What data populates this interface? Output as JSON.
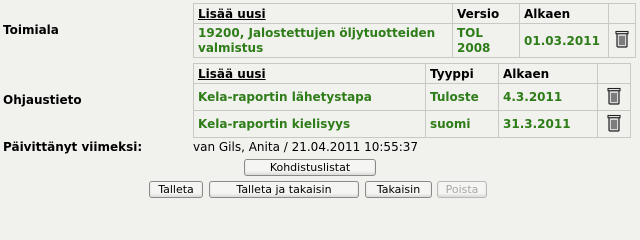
{
  "toimiala": {
    "label": "Toimiala",
    "add_link": "Lisää uusi",
    "col_versio": "Versio",
    "col_alkaen": "Alkaen",
    "row": {
      "name": "19200, Jalostettujen öljytuotteiden valmistus",
      "versio": "TOL 2008",
      "alkaen": "01.03.2011"
    }
  },
  "ohjaustieto": {
    "label": "Ohjaustieto",
    "add_link": "Lisää uusi",
    "col_tyyppi": "Tyyppi",
    "col_alkaen": "Alkaen",
    "rows": [
      {
        "name": "Kela-raportin lähetystapa",
        "tyyppi": "Tuloste",
        "alkaen": "4.3.2011"
      },
      {
        "name": "Kela-raportin kielisyys",
        "tyyppi": "suomi",
        "alkaen": "31.3.2011"
      }
    ]
  },
  "updated": {
    "label": "Päivittänyt viimeksi:",
    "value": "van Gils, Anita / 21.04.2011 10:55:37"
  },
  "buttons": {
    "kohdistuslistat": "Kohdistuslistat",
    "talleta": "Talleta",
    "talleta_takaisin": "Talleta ja takaisin",
    "takaisin": "Takaisin",
    "poista": "Poista"
  }
}
